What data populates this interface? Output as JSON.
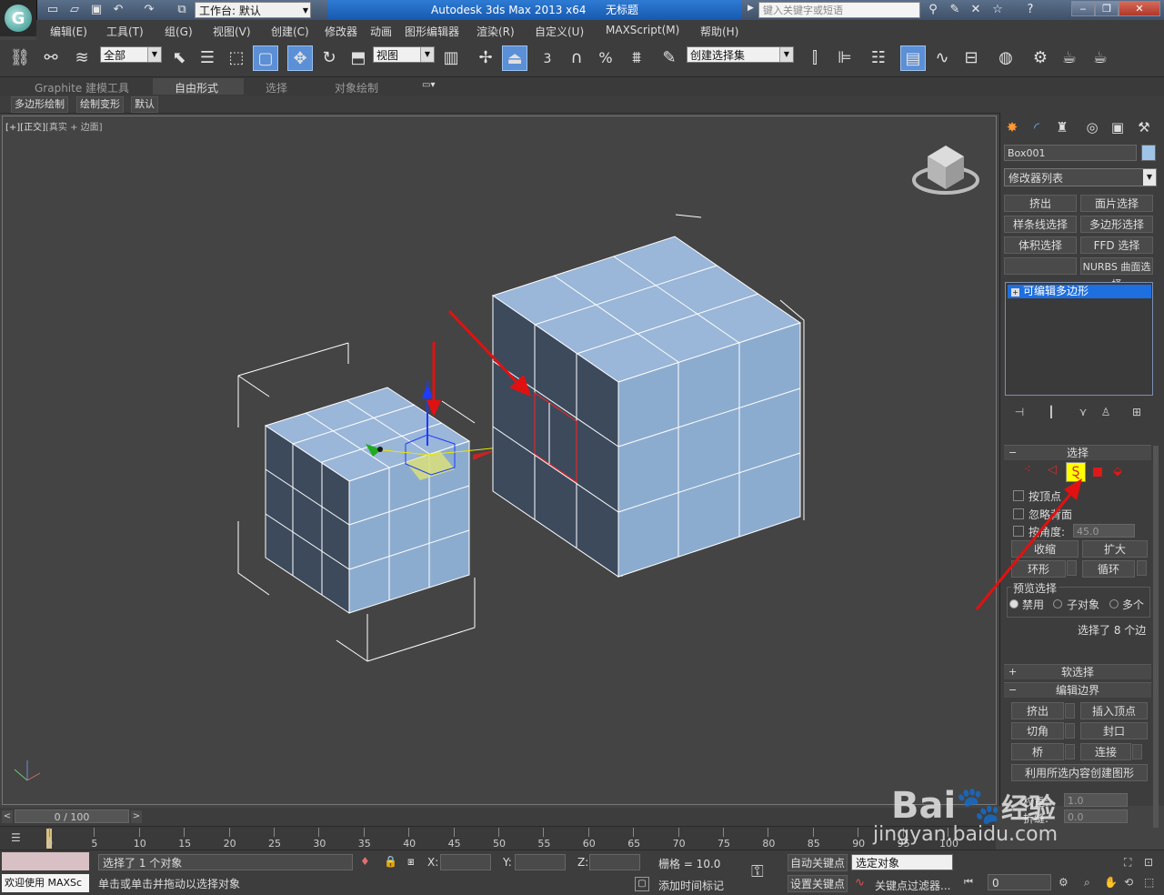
{
  "titlebar": {
    "workspace_label": "工作台: 默认",
    "app_name": "Autodesk 3ds Max  2013 x64",
    "doc_name": "无标题",
    "search_placeholder": "键入关键字或短语"
  },
  "menu": [
    "编辑(E)",
    "工具(T)",
    "组(G)",
    "视图(V)",
    "创建(C)",
    "修改器",
    "动画",
    "图形编辑器",
    "渲染(R)",
    "自定义(U)",
    "MAXScript(M)",
    "帮助(H)"
  ],
  "toolbar": {
    "selection_filter": "全部",
    "ref_coord": "视图",
    "named_selection": "创建选择集",
    "snap_3": "3",
    "snap_angle": "⊿",
    "snap_percent": "%"
  },
  "ribbon": {
    "tabs": [
      "Graphite 建模工具",
      "自由形式",
      "选择",
      "对象绘制"
    ],
    "active_tab": "自由形式",
    "subtabs": [
      "多边形绘制",
      "绘制变形",
      "默认"
    ]
  },
  "viewport": {
    "label_bracket_plus": "[+]",
    "label_view": "[正交]",
    "label_shading": "[真实 + 边面]"
  },
  "panel": {
    "object_name": "Box001",
    "object_color": "#9fc4e8",
    "modifier_list": "修改器列表",
    "quick_buttons": [
      "挤出",
      "面片选择",
      "样条线选择",
      "多边形选择",
      "体积选择",
      "FFD 选择",
      "",
      "NURBS 曲面选择"
    ],
    "stack_item": "可编辑多边形",
    "selection": {
      "header": "选择",
      "by_vertex": "按顶点",
      "ignore_backface": "忽略背面",
      "by_angle": "按角度:",
      "angle_value": "45.0",
      "shrink": "收缩",
      "grow": "扩大",
      "ring": "环形",
      "loop": "循环",
      "preview_label": "预览选择",
      "preview_options": [
        "禁用",
        "子对象",
        "多个"
      ],
      "status": "选择了 8 个边"
    },
    "soft_selection_header": "软选择",
    "edit_edges": {
      "header": "编辑边界",
      "buttons": [
        "挤出",
        "插入顶点",
        "切角",
        "封口",
        "桥",
        "连接"
      ],
      "create_shape": "利用所选内容创建图形",
      "weight_label": "权重:",
      "weight_value": "1.0",
      "crease_label": "折缝:",
      "crease_value": "0.0"
    }
  },
  "timeline": {
    "frame_display": "0 / 100",
    "ticks": [
      "0",
      "5",
      "10",
      "15",
      "20",
      "25",
      "30",
      "35",
      "40",
      "45",
      "50",
      "55",
      "60",
      "65",
      "70",
      "75",
      "80",
      "85",
      "90",
      "95",
      "100"
    ]
  },
  "status": {
    "welcome": "欢迎使用 MAXSc",
    "selected_count": "选择了 1 个对象",
    "hint": "单击或单击并拖动以选择对象",
    "x_label": "X:",
    "y_label": "Y:",
    "z_label": "Z:",
    "grid": "栅格 = 10.0",
    "add_time_tag": "添加时间标记",
    "auto_key": "自动关键点",
    "set_key": "设置关键点",
    "selected_object": "选定对象",
    "key_filters": "关键点过滤器...",
    "frame": "0"
  },
  "watermark": {
    "brand": "Bai",
    "brand_suffix": "经验",
    "url": "jingyan.baidu.com"
  },
  "colors": {
    "accent_blue": "#1e6fe0",
    "highlight_yellow": "#ffff00",
    "annotation_red": "#e11111",
    "selection_red": "#ff2020",
    "cube_face": "#93afd0"
  }
}
